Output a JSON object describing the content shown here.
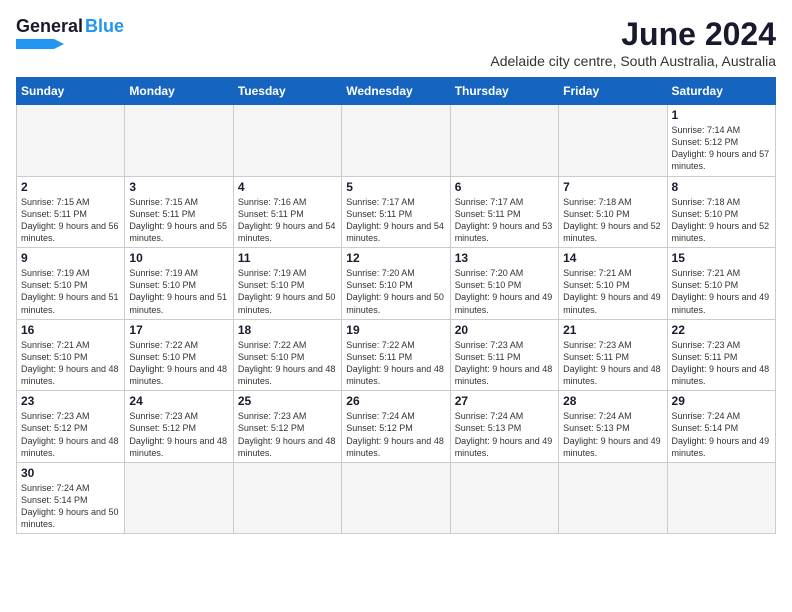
{
  "header": {
    "logo_general": "General",
    "logo_blue": "Blue",
    "month_title": "June 2024",
    "location": "Adelaide city centre, South Australia, Australia"
  },
  "weekdays": [
    "Sunday",
    "Monday",
    "Tuesday",
    "Wednesday",
    "Thursday",
    "Friday",
    "Saturday"
  ],
  "days": [
    {
      "num": "",
      "sunrise": "",
      "sunset": "",
      "daylight": ""
    },
    {
      "num": "",
      "sunrise": "",
      "sunset": "",
      "daylight": ""
    },
    {
      "num": "",
      "sunrise": "",
      "sunset": "",
      "daylight": ""
    },
    {
      "num": "",
      "sunrise": "",
      "sunset": "",
      "daylight": ""
    },
    {
      "num": "",
      "sunrise": "",
      "sunset": "",
      "daylight": ""
    },
    {
      "num": "",
      "sunrise": "",
      "sunset": "",
      "daylight": ""
    },
    {
      "num": "1",
      "sunrise": "Sunrise: 7:14 AM",
      "sunset": "Sunset: 5:12 PM",
      "daylight": "Daylight: 9 hours and 57 minutes."
    },
    {
      "num": "2",
      "sunrise": "Sunrise: 7:15 AM",
      "sunset": "Sunset: 5:11 PM",
      "daylight": "Daylight: 9 hours and 56 minutes."
    },
    {
      "num": "3",
      "sunrise": "Sunrise: 7:15 AM",
      "sunset": "Sunset: 5:11 PM",
      "daylight": "Daylight: 9 hours and 55 minutes."
    },
    {
      "num": "4",
      "sunrise": "Sunrise: 7:16 AM",
      "sunset": "Sunset: 5:11 PM",
      "daylight": "Daylight: 9 hours and 54 minutes."
    },
    {
      "num": "5",
      "sunrise": "Sunrise: 7:17 AM",
      "sunset": "Sunset: 5:11 PM",
      "daylight": "Daylight: 9 hours and 54 minutes."
    },
    {
      "num": "6",
      "sunrise": "Sunrise: 7:17 AM",
      "sunset": "Sunset: 5:11 PM",
      "daylight": "Daylight: 9 hours and 53 minutes."
    },
    {
      "num": "7",
      "sunrise": "Sunrise: 7:18 AM",
      "sunset": "Sunset: 5:10 PM",
      "daylight": "Daylight: 9 hours and 52 minutes."
    },
    {
      "num": "8",
      "sunrise": "Sunrise: 7:18 AM",
      "sunset": "Sunset: 5:10 PM",
      "daylight": "Daylight: 9 hours and 52 minutes."
    },
    {
      "num": "9",
      "sunrise": "Sunrise: 7:19 AM",
      "sunset": "Sunset: 5:10 PM",
      "daylight": "Daylight: 9 hours and 51 minutes."
    },
    {
      "num": "10",
      "sunrise": "Sunrise: 7:19 AM",
      "sunset": "Sunset: 5:10 PM",
      "daylight": "Daylight: 9 hours and 51 minutes."
    },
    {
      "num": "11",
      "sunrise": "Sunrise: 7:19 AM",
      "sunset": "Sunset: 5:10 PM",
      "daylight": "Daylight: 9 hours and 50 minutes."
    },
    {
      "num": "12",
      "sunrise": "Sunrise: 7:20 AM",
      "sunset": "Sunset: 5:10 PM",
      "daylight": "Daylight: 9 hours and 50 minutes."
    },
    {
      "num": "13",
      "sunrise": "Sunrise: 7:20 AM",
      "sunset": "Sunset: 5:10 PM",
      "daylight": "Daylight: 9 hours and 49 minutes."
    },
    {
      "num": "14",
      "sunrise": "Sunrise: 7:21 AM",
      "sunset": "Sunset: 5:10 PM",
      "daylight": "Daylight: 9 hours and 49 minutes."
    },
    {
      "num": "15",
      "sunrise": "Sunrise: 7:21 AM",
      "sunset": "Sunset: 5:10 PM",
      "daylight": "Daylight: 9 hours and 49 minutes."
    },
    {
      "num": "16",
      "sunrise": "Sunrise: 7:21 AM",
      "sunset": "Sunset: 5:10 PM",
      "daylight": "Daylight: 9 hours and 48 minutes."
    },
    {
      "num": "17",
      "sunrise": "Sunrise: 7:22 AM",
      "sunset": "Sunset: 5:10 PM",
      "daylight": "Daylight: 9 hours and 48 minutes."
    },
    {
      "num": "18",
      "sunrise": "Sunrise: 7:22 AM",
      "sunset": "Sunset: 5:10 PM",
      "daylight": "Daylight: 9 hours and 48 minutes."
    },
    {
      "num": "19",
      "sunrise": "Sunrise: 7:22 AM",
      "sunset": "Sunset: 5:11 PM",
      "daylight": "Daylight: 9 hours and 48 minutes."
    },
    {
      "num": "20",
      "sunrise": "Sunrise: 7:23 AM",
      "sunset": "Sunset: 5:11 PM",
      "daylight": "Daylight: 9 hours and 48 minutes."
    },
    {
      "num": "21",
      "sunrise": "Sunrise: 7:23 AM",
      "sunset": "Sunset: 5:11 PM",
      "daylight": "Daylight: 9 hours and 48 minutes."
    },
    {
      "num": "22",
      "sunrise": "Sunrise: 7:23 AM",
      "sunset": "Sunset: 5:11 PM",
      "daylight": "Daylight: 9 hours and 48 minutes."
    },
    {
      "num": "23",
      "sunrise": "Sunrise: 7:23 AM",
      "sunset": "Sunset: 5:12 PM",
      "daylight": "Daylight: 9 hours and 48 minutes."
    },
    {
      "num": "24",
      "sunrise": "Sunrise: 7:23 AM",
      "sunset": "Sunset: 5:12 PM",
      "daylight": "Daylight: 9 hours and 48 minutes."
    },
    {
      "num": "25",
      "sunrise": "Sunrise: 7:23 AM",
      "sunset": "Sunset: 5:12 PM",
      "daylight": "Daylight: 9 hours and 48 minutes."
    },
    {
      "num": "26",
      "sunrise": "Sunrise: 7:24 AM",
      "sunset": "Sunset: 5:12 PM",
      "daylight": "Daylight: 9 hours and 48 minutes."
    },
    {
      "num": "27",
      "sunrise": "Sunrise: 7:24 AM",
      "sunset": "Sunset: 5:13 PM",
      "daylight": "Daylight: 9 hours and 49 minutes."
    },
    {
      "num": "28",
      "sunrise": "Sunrise: 7:24 AM",
      "sunset": "Sunset: 5:13 PM",
      "daylight": "Daylight: 9 hours and 49 minutes."
    },
    {
      "num": "29",
      "sunrise": "Sunrise: 7:24 AM",
      "sunset": "Sunset: 5:14 PM",
      "daylight": "Daylight: 9 hours and 49 minutes."
    },
    {
      "num": "30",
      "sunrise": "Sunrise: 7:24 AM",
      "sunset": "Sunset: 5:14 PM",
      "daylight": "Daylight: 9 hours and 50 minutes."
    }
  ]
}
